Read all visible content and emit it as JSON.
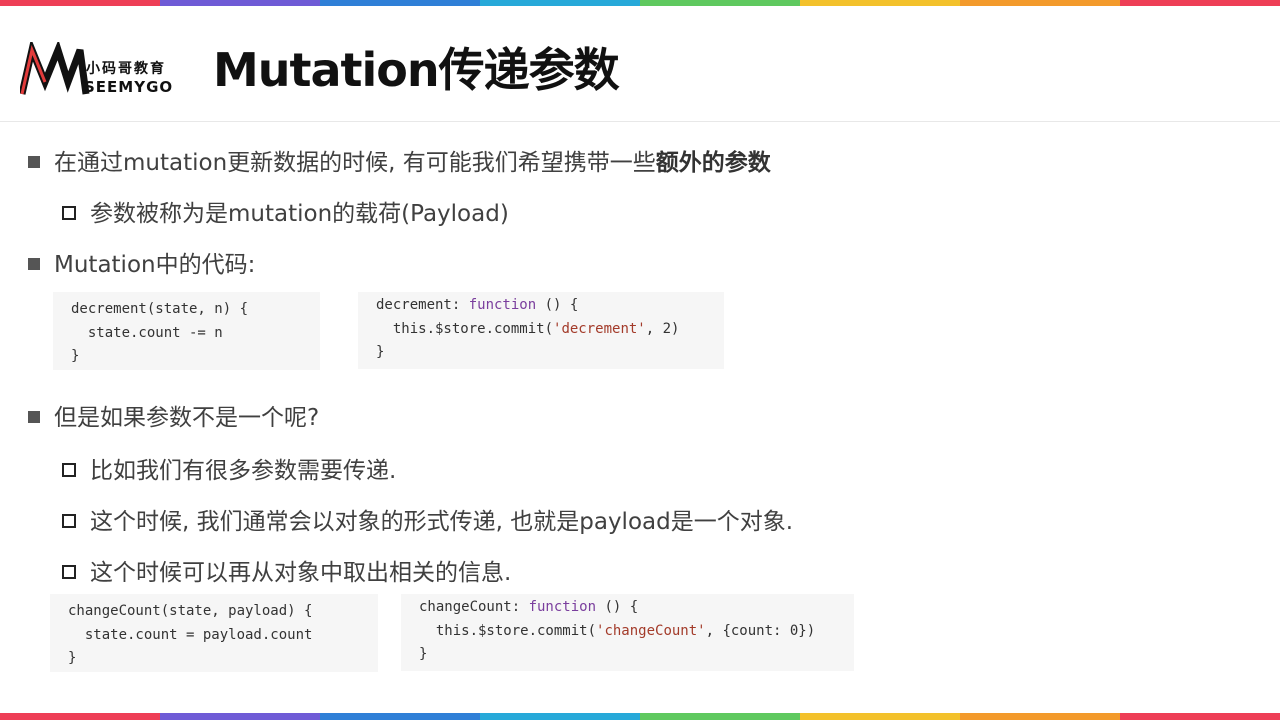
{
  "stripe_colors": [
    "#ee3e56",
    "#6f5bd6",
    "#2f7fd7",
    "#27a9d9",
    "#5fc95f",
    "#f3c12b",
    "#f39a2b",
    "#ee3e56"
  ],
  "logo": {
    "cn": "小码哥教育",
    "en": "SEEMYGO"
  },
  "title": "Mutation传递参数",
  "bullets": {
    "b1": "在通过mutation更新数据的时候, 有可能我们希望携带一些",
    "b1_strong": "额外的参数",
    "b1_sub": "参数被称为是mutation的载荷(Payload)",
    "b2": "Mutation中的代码:",
    "b3": "但是如果参数不是一个呢?",
    "b3_sub1": "比如我们有很多参数需要传递.",
    "b3_sub2": "这个时候, 我们通常会以对象的形式传递, 也就是payload是一个对象.",
    "b3_sub3": "这个时候可以再从对象中取出相关的信息."
  },
  "code1": {
    "line1": "decrement(state, n) {",
    "line2": "  state.count -= n",
    "line3": "}"
  },
  "code2": {
    "l1_a": "decrement: ",
    "l1_kw": "function",
    "l1_b": " () {",
    "l2_a": "  this.$store.commit(",
    "l2_str": "'decrement'",
    "l2_b": ", 2)",
    "l3": "}"
  },
  "code3": {
    "line1": "changeCount(state, payload) {",
    "line2": "  state.count = payload.count",
    "line3": "}"
  },
  "code4": {
    "l1_a": "changeCount: ",
    "l1_kw": "function",
    "l1_b": " () {",
    "l2_a": "  this.$store.commit(",
    "l2_str": "'changeCount'",
    "l2_b": ", {count: 0})",
    "l3": "}"
  }
}
